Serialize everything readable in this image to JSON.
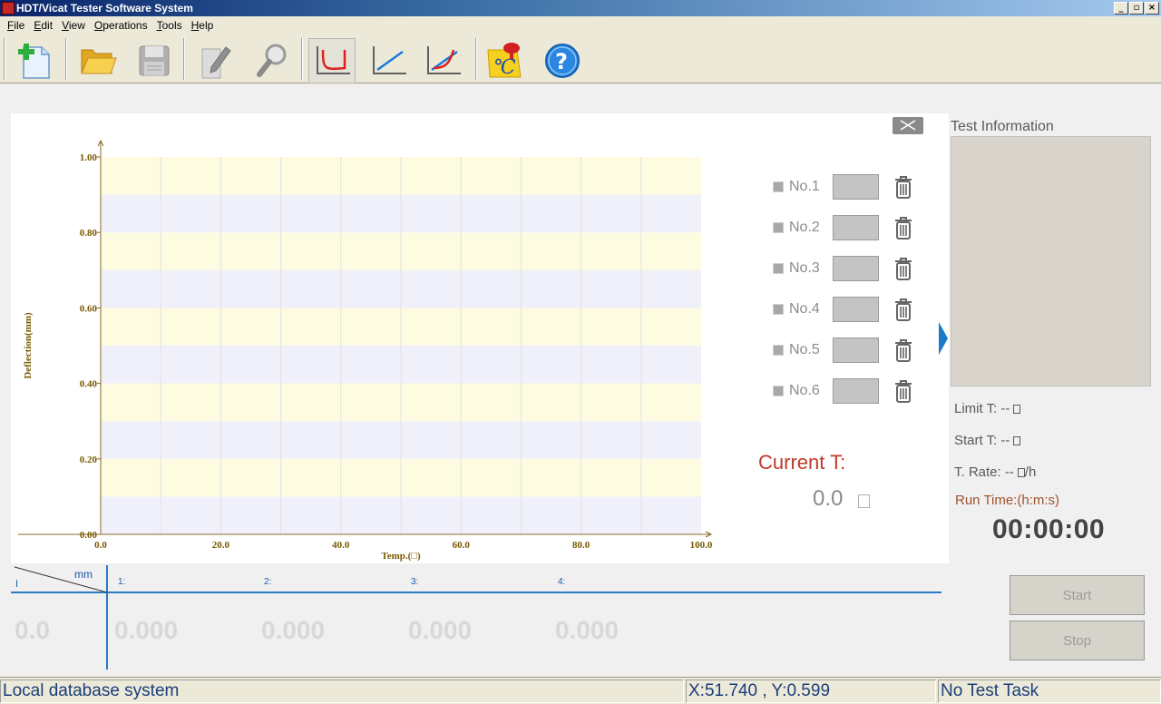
{
  "window": {
    "title": "HDT/Vicat Tester Software System",
    "min": "_",
    "restore": "▫",
    "close": "×"
  },
  "menu": [
    {
      "key": "F",
      "rest": "ile"
    },
    {
      "key": "E",
      "rest": "dit"
    },
    {
      "key": "V",
      "rest": "iew"
    },
    {
      "key": "O",
      "rest": "perations"
    },
    {
      "key": "T",
      "rest": "ools"
    },
    {
      "key": "H",
      "rest": "elp"
    }
  ],
  "toolbar": {
    "icons": [
      "new-file-icon",
      "open-folder-icon",
      "save-disk-icon",
      "edit-pencil-icon",
      "search-magnifier-icon",
      "hdt-curve-icon",
      "vicat-line-icon",
      "combined-curve-icon",
      "temperature-calibration-icon",
      "help-icon"
    ]
  },
  "chart_data": {
    "type": "line",
    "xlabel": "Temp.(□)",
    "ylabel": "Deflection(mm)",
    "xlim": [
      0,
      100
    ],
    "ylim": [
      0,
      1
    ],
    "x_ticks": [
      "0.0",
      "20.0",
      "40.0",
      "60.0",
      "80.0",
      "100.0"
    ],
    "y_ticks": [
      "0.00",
      "0.20",
      "0.40",
      "0.60",
      "0.80",
      "1.00"
    ],
    "series": [],
    "grid": true,
    "band_colors": [
      "#fdfbe0",
      "#f0f0fa"
    ],
    "axis_color": "#8b6a2a",
    "label_color": "#7a5a00"
  },
  "samples": [
    {
      "label": "No.1"
    },
    {
      "label": "No.2"
    },
    {
      "label": "No.3"
    },
    {
      "label": "No.4"
    },
    {
      "label": "No.5"
    },
    {
      "label": "No.6"
    }
  ],
  "current": {
    "label": "Current T:",
    "value": "0.0"
  },
  "info": {
    "title": "Test Information",
    "limit_t": "Limit T: --",
    "start_t": "Start T: --",
    "t_rate": "T. Rate: --",
    "t_rate_unit": "/h",
    "run_time_label": "Run Time:(h:m:s)",
    "run_time": "00:00:00"
  },
  "readout": {
    "unit": "mm",
    "corner_mark": "I",
    "main_value": "0.0",
    "channels": [
      {
        "label": "1:",
        "value": "0.000"
      },
      {
        "label": "2:",
        "value": "0.000"
      },
      {
        "label": "3:",
        "value": "0.000"
      },
      {
        "label": "4:",
        "value": "0.000"
      }
    ]
  },
  "buttons": {
    "start": "Start",
    "stop": "Stop"
  },
  "status": {
    "db": "Local database system",
    "coords": "X:51.740 , Y:0.599",
    "task": "No Test Task"
  }
}
